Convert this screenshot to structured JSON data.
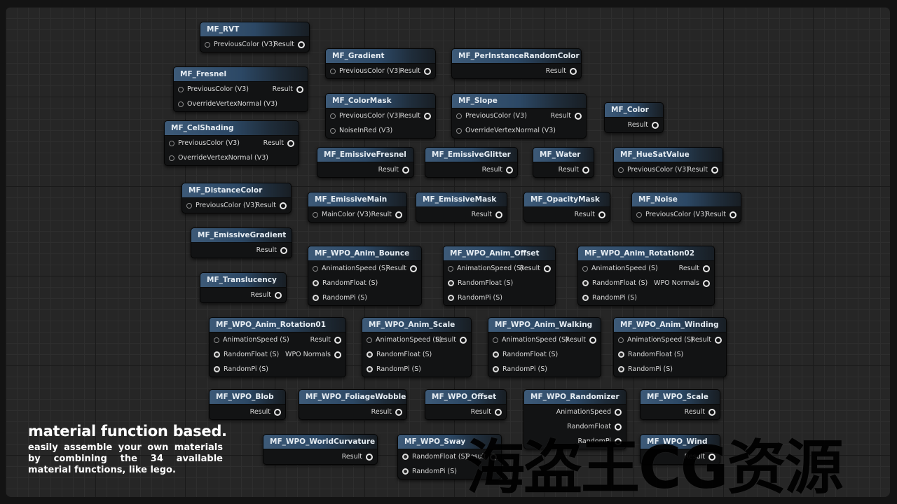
{
  "caption": {
    "title": "material function based.",
    "body": "easily assemble your own materials by combining the 34 available material functions, like lego."
  },
  "watermark": "海盗王CG资源",
  "colors": {
    "header_start": "#3d5a78",
    "node_body": "#121314",
    "grid": "#262626"
  },
  "nodes": [
    {
      "id": "mf-rvt",
      "title": "MF_RVT",
      "rows": [
        {
          "in": "PreviousColor (V3)",
          "pin": "empty",
          "out": "Result"
        }
      ]
    },
    {
      "id": "mf-gradient",
      "title": "MF_Gradient",
      "rows": [
        {
          "in": "PreviousColor (V3)",
          "pin": "empty",
          "out": "Result"
        }
      ]
    },
    {
      "id": "mf-perinstancerandomcolor",
      "title": "MF_PerInstanceRandomColor",
      "rows": [
        {
          "out": "Result"
        }
      ]
    },
    {
      "id": "mf-fresnel",
      "title": "MF_Fresnel",
      "rows": [
        {
          "in": "PreviousColor (V3)",
          "pin": "empty",
          "out": "Result"
        },
        {
          "in": "OverrideVertexNormal (V3)",
          "pin": "empty"
        }
      ]
    },
    {
      "id": "mf-colormask",
      "title": "MF_ColorMask",
      "rows": [
        {
          "in": "PreviousColor (V3)",
          "pin": "empty",
          "out": "Result"
        },
        {
          "in": "NoiseInRed (V3)",
          "pin": "empty"
        }
      ]
    },
    {
      "id": "mf-slope",
      "title": "MF_Slope",
      "rows": [
        {
          "in": "PreviousColor (V3)",
          "pin": "empty",
          "out": "Result"
        },
        {
          "in": "OverrideVertexNormal (V3)",
          "pin": "empty"
        }
      ]
    },
    {
      "id": "mf-color",
      "title": "MF_Color",
      "rows": [
        {
          "out": "Result"
        }
      ]
    },
    {
      "id": "mf-celshading",
      "title": "MF_CelShading",
      "rows": [
        {
          "in": "PreviousColor (V3)",
          "pin": "empty",
          "out": "Result"
        },
        {
          "in": "OverrideVertexNormal (V3)",
          "pin": "empty"
        }
      ]
    },
    {
      "id": "mf-emissivefresnel",
      "title": "MF_EmissiveFresnel",
      "rows": [
        {
          "out": "Result"
        }
      ]
    },
    {
      "id": "mf-emissiveglitter",
      "title": "MF_EmissiveGlitter",
      "rows": [
        {
          "out": "Result"
        }
      ]
    },
    {
      "id": "mf-water",
      "title": "MF_Water",
      "rows": [
        {
          "out": "Result"
        }
      ]
    },
    {
      "id": "mf-huesatvalue",
      "title": "MF_HueSatValue",
      "rows": [
        {
          "in": "PreviousColor (V3)",
          "pin": "empty",
          "out": "Result"
        }
      ]
    },
    {
      "id": "mf-distancecolor",
      "title": "MF_DistanceColor",
      "rows": [
        {
          "in": "PreviousColor (V3)",
          "pin": "empty",
          "out": "Result"
        }
      ]
    },
    {
      "id": "mf-emissivemain",
      "title": "MF_EmissiveMain",
      "rows": [
        {
          "in": "MainColor (V3)",
          "pin": "empty",
          "out": "Result"
        }
      ]
    },
    {
      "id": "mf-emissivemask",
      "title": "MF_EmissiveMask",
      "rows": [
        {
          "out": "Result"
        }
      ]
    },
    {
      "id": "mf-opacitymask",
      "title": "MF_OpacityMask",
      "rows": [
        {
          "out": "Result"
        }
      ]
    },
    {
      "id": "mf-noise",
      "title": "MF_Noise",
      "rows": [
        {
          "in": "PreviousColor (V3)",
          "pin": "empty",
          "out": "Result"
        }
      ]
    },
    {
      "id": "mf-emissivegradient",
      "title": "MF_EmissiveGradient",
      "rows": [
        {
          "out": "Result"
        }
      ]
    },
    {
      "id": "mf-wpo-anim-bounce",
      "title": "MF_WPO_Anim_Bounce",
      "rows": [
        {
          "in": "AnimationSpeed (S)",
          "pin": "empty",
          "out": "Result"
        },
        {
          "in": "RandomFloat (S)",
          "pin": "lit"
        },
        {
          "in": "RandomPi (S)",
          "pin": "lit"
        }
      ]
    },
    {
      "id": "mf-wpo-anim-offset",
      "title": "MF_WPO_Anim_Offset",
      "rows": [
        {
          "in": "AnimationSpeed (S)",
          "pin": "empty",
          "out": "Result"
        },
        {
          "in": "RandomFloat (S)",
          "pin": "lit"
        },
        {
          "in": "RandomPi (S)",
          "pin": "lit"
        }
      ]
    },
    {
      "id": "mf-wpo-anim-rotation02",
      "title": "MF_WPO_Anim_Rotation02",
      "rows": [
        {
          "in": "AnimationSpeed (S)",
          "pin": "empty",
          "out": "Result"
        },
        {
          "in": "RandomFloat (S)",
          "pin": "lit",
          "out": "WPO Normals"
        },
        {
          "in": "RandomPi (S)",
          "pin": "lit"
        }
      ]
    },
    {
      "id": "mf-translucency",
      "title": "MF_Translucency",
      "rows": [
        {
          "out": "Result"
        }
      ]
    },
    {
      "id": "mf-wpo-anim-rotation01",
      "title": "MF_WPO_Anim_Rotation01",
      "rows": [
        {
          "in": "AnimationSpeed (S)",
          "pin": "empty",
          "out": "Result"
        },
        {
          "in": "RandomFloat (S)",
          "pin": "lit",
          "out": "WPO Normals"
        },
        {
          "in": "RandomPi (S)",
          "pin": "lit"
        }
      ]
    },
    {
      "id": "mf-wpo-anim-scale",
      "title": "MF_WPO_Anim_Scale",
      "rows": [
        {
          "in": "AnimationSpeed (S)",
          "pin": "empty",
          "out": "Result"
        },
        {
          "in": "RandomFloat (S)",
          "pin": "lit"
        },
        {
          "in": "RandomPi (S)",
          "pin": "lit"
        }
      ]
    },
    {
      "id": "mf-wpo-anim-walking",
      "title": "MF_WPO_Anim_Walking",
      "rows": [
        {
          "in": "AnimationSpeed (S)",
          "pin": "empty",
          "out": "Result"
        },
        {
          "in": "RandomFloat (S)",
          "pin": "lit"
        },
        {
          "in": "RandomPi (S)",
          "pin": "lit"
        }
      ]
    },
    {
      "id": "mf-wpo-anim-winding",
      "title": "MF_WPO_Anim_Winding",
      "rows": [
        {
          "in": "AnimationSpeed (S)",
          "pin": "empty",
          "out": "Result"
        },
        {
          "in": "RandomFloat (S)",
          "pin": "lit"
        },
        {
          "in": "RandomPi (S)",
          "pin": "lit"
        }
      ]
    },
    {
      "id": "mf-wpo-blob",
      "title": "MF_WPO_Blob",
      "rows": [
        {
          "out": "Result"
        }
      ]
    },
    {
      "id": "mf-wpo-foliagewobble",
      "title": "MF_WPO_FoliageWobble",
      "rows": [
        {
          "out": "Result"
        }
      ]
    },
    {
      "id": "mf-wpo-offset",
      "title": "MF_WPO_Offset",
      "rows": [
        {
          "out": "Result"
        }
      ]
    },
    {
      "id": "mf-wpo-randomizer",
      "title": "MF_WPO_Randomizer",
      "rows": [
        {
          "out": "AnimationSpeed"
        },
        {
          "out": "RandomFloat"
        },
        {
          "out": "RandomPi"
        }
      ]
    },
    {
      "id": "mf-wpo-scale",
      "title": "MF_WPO_Scale",
      "rows": [
        {
          "out": "Result"
        }
      ]
    },
    {
      "id": "mf-wpo-worldcurvature",
      "title": "MF_WPO_WorldCurvature",
      "rows": [
        {
          "out": "Result"
        }
      ]
    },
    {
      "id": "mf-wpo-sway",
      "title": "MF_WPO_Sway",
      "rows": [
        {
          "in": "RandomFloat (S)",
          "pin": "lit",
          "out": "Result"
        },
        {
          "in": "RandomPi (S)",
          "pin": "lit"
        }
      ]
    },
    {
      "id": "mf-wpo-wind",
      "title": "MF_WPO_Wind",
      "rows": [
        {
          "out": "Result"
        }
      ]
    }
  ]
}
